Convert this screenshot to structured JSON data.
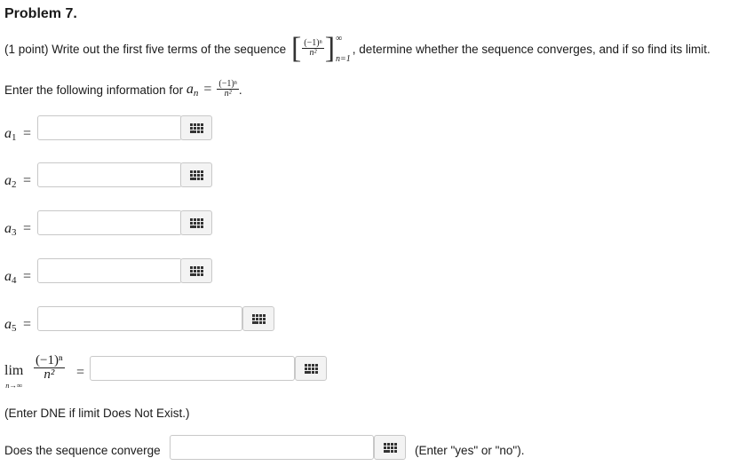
{
  "problem": {
    "title": "Problem 7.",
    "points": "(1 point)",
    "text_before": "Write out the first five terms of the sequence",
    "text_after": ", determine whether the sequence converges, and if so find its limit.",
    "seq_num": "(−1)ⁿ",
    "seq_den": "n²",
    "seq_sup": "∞",
    "seq_sub": "n=1"
  },
  "enter_info": {
    "text": "Enter the following information for",
    "var": "a",
    "var_sub": "n",
    "equals": "=",
    "frac_num": "(−1)ⁿ",
    "frac_den": "n²",
    "period": "."
  },
  "terms": [
    {
      "label": "a",
      "sub": "1",
      "equals": "=",
      "value": ""
    },
    {
      "label": "a",
      "sub": "2",
      "equals": "=",
      "value": ""
    },
    {
      "label": "a",
      "sub": "3",
      "equals": "=",
      "value": ""
    },
    {
      "label": "a",
      "sub": "4",
      "equals": "=",
      "value": ""
    },
    {
      "label": "a",
      "sub": "5",
      "equals": "=",
      "value": ""
    }
  ],
  "limit": {
    "lim": "lim",
    "under": "n→∞",
    "num": "(−1)ⁿ",
    "den": "n²",
    "equals": "=",
    "value": "",
    "note": "(Enter DNE if limit Does Not Exist.)"
  },
  "converge": {
    "label": "Does the sequence converge",
    "value": "",
    "note": "(Enter \"yes\" or \"no\")."
  },
  "icons": {
    "equation_editor": "equation-editor-grid-icon"
  }
}
